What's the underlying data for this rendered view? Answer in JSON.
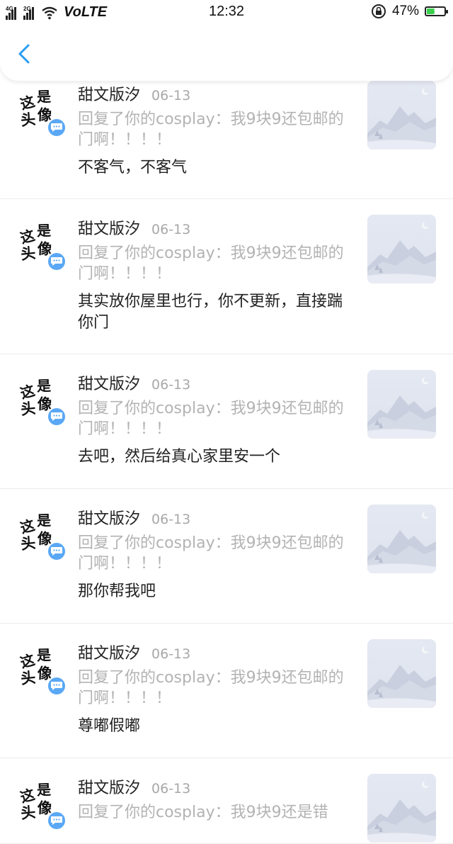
{
  "status_bar": {
    "network_1": "4G",
    "network_2": "2G",
    "carrier_mode": "VoLTE",
    "time": "12:32",
    "battery": "47%",
    "battery_level": 0.47,
    "battery_color": "#3ccf4e"
  },
  "nav": {
    "back_icon": "chevron-left-icon",
    "accent": "#2a9df4"
  },
  "avatar_text": "这是头像",
  "comments": [
    {
      "user": "甜文版汐",
      "date": "06-13",
      "quote": "回复了你的cosplay：我9块9还包邮的门啊！！！！",
      "reply": "不客气，不客气"
    },
    {
      "user": "甜文版汐",
      "date": "06-13",
      "quote": "回复了你的cosplay：我9块9还包邮的门啊！！！！",
      "reply": "其实放你屋里也行，你不更新，直接踹你门"
    },
    {
      "user": "甜文版汐",
      "date": "06-13",
      "quote": "回复了你的cosplay：我9块9还包邮的门啊！！！！",
      "reply": "去吧，然后给真心家里安一个"
    },
    {
      "user": "甜文版汐",
      "date": "06-13",
      "quote": "回复了你的cosplay：我9块9还包邮的门啊！！！！",
      "reply": "那你帮我吧"
    },
    {
      "user": "甜文版汐",
      "date": "06-13",
      "quote": "回复了你的cosplay：我9块9还包邮的门啊！！！！",
      "reply": "尊嘟假嘟"
    },
    {
      "user": "甜文版汐",
      "date": "06-13",
      "quote": "回复了你的cosplay：我9块9还是错",
      "reply": ""
    }
  ]
}
